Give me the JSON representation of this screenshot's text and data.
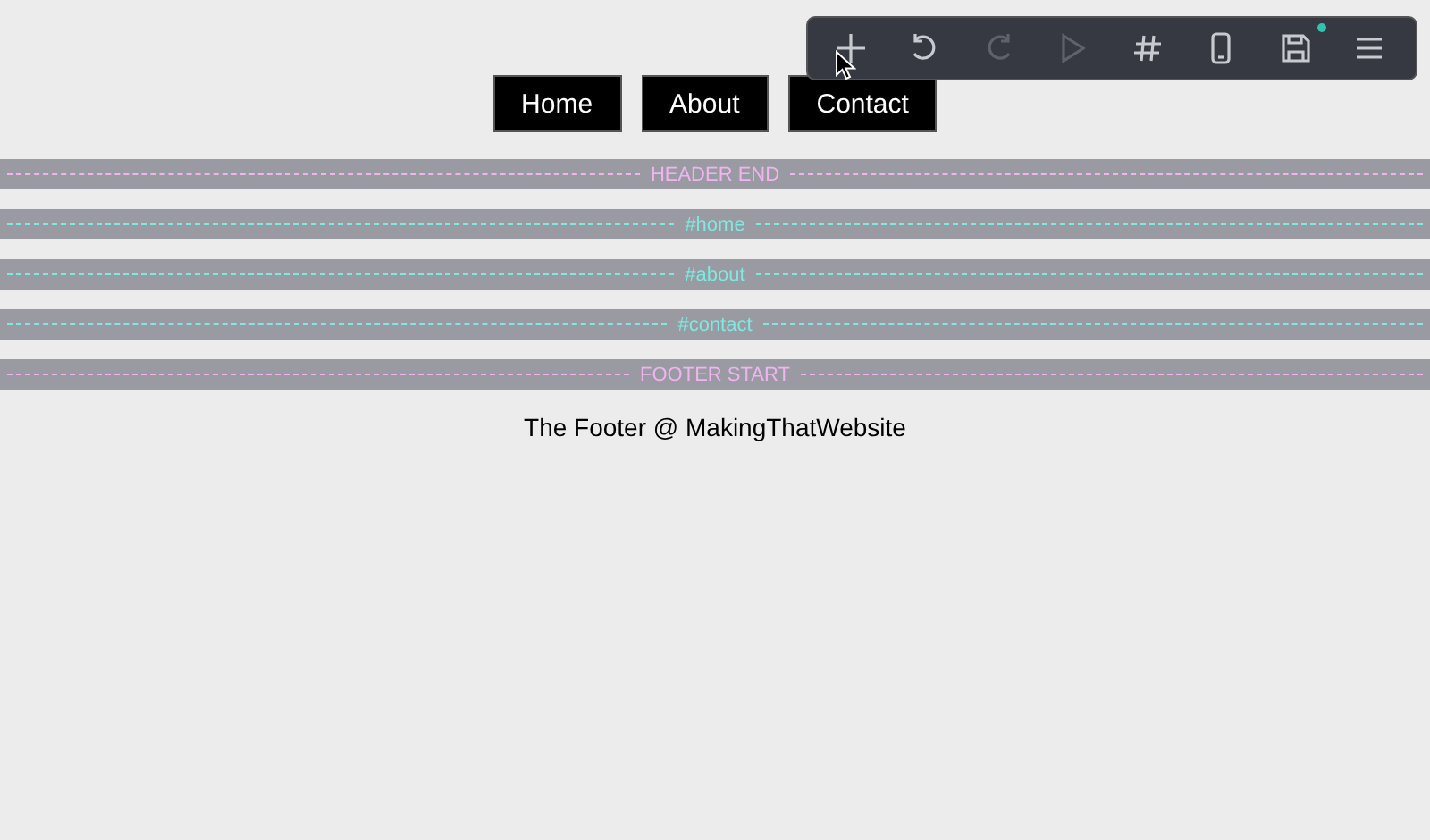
{
  "toolbar": {
    "tools": [
      {
        "kind": "add",
        "disabled": false,
        "unsaved": false
      },
      {
        "kind": "undo",
        "disabled": false,
        "unsaved": false
      },
      {
        "kind": "redo",
        "disabled": true,
        "unsaved": false
      },
      {
        "kind": "play",
        "disabled": true,
        "unsaved": false
      },
      {
        "kind": "grid",
        "disabled": false,
        "unsaved": false
      },
      {
        "kind": "mobile",
        "disabled": false,
        "unsaved": false
      },
      {
        "kind": "save",
        "disabled": false,
        "unsaved": true
      },
      {
        "kind": "menu",
        "disabled": false,
        "unsaved": false
      }
    ]
  },
  "nav": {
    "links": [
      "Home",
      "About",
      "Contact"
    ]
  },
  "dividers": [
    {
      "label": "HEADER END",
      "color": "#f0b4f0"
    },
    {
      "label": "#home",
      "color": "#7fe8e0"
    },
    {
      "label": "#about",
      "color": "#7fe8e0"
    },
    {
      "label": "#contact",
      "color": "#7fe8e0"
    },
    {
      "label": "FOOTER START",
      "color": "#f0b4f0"
    }
  ],
  "footer": {
    "text": "The Footer @ MakingThatWebsite"
  }
}
